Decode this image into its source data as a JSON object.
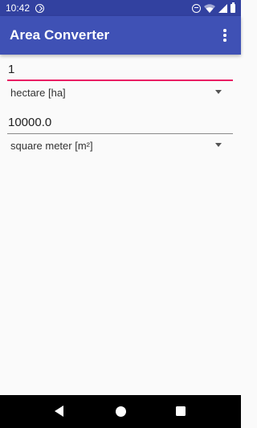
{
  "status_bar": {
    "time": "10:42"
  },
  "app_bar": {
    "title": "Area Converter",
    "overflow_icon": "more-vert-icon"
  },
  "converter": {
    "from_value": "1",
    "from_unit": "hectare [ha]",
    "to_value": "10000.0",
    "to_unit": "square meter [m²]"
  },
  "colors": {
    "primary": "#3f51b5",
    "primary_dark": "#3241a0",
    "accent": "#e91e63"
  },
  "nav_bar": {
    "back_icon": "back-triangle-icon",
    "home_icon": "home-circle-icon",
    "recents_icon": "recents-square-icon"
  }
}
